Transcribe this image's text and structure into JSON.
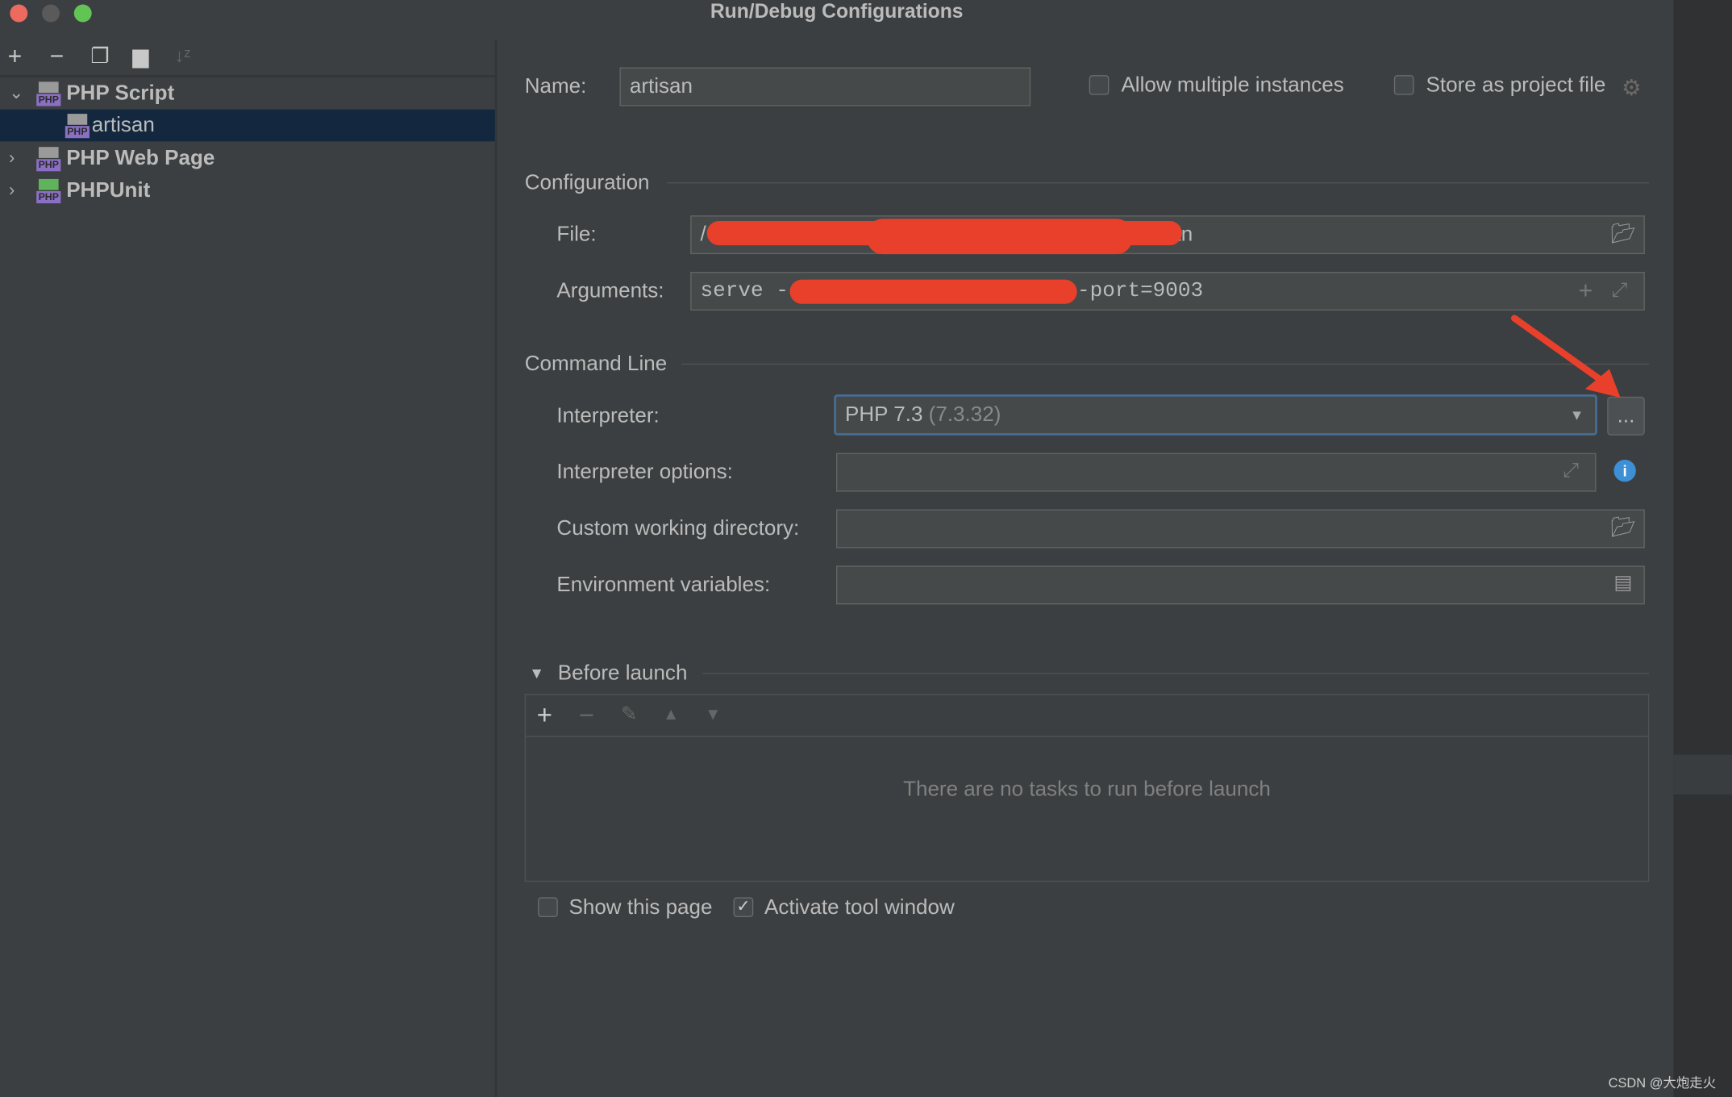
{
  "window": {
    "title": "Run/Debug Configurations"
  },
  "toolbar": {
    "icons": [
      "plus-icon",
      "minus-icon",
      "copy-icon",
      "folder-add-icon",
      "sort-icon"
    ]
  },
  "tree": {
    "items": [
      {
        "label": "PHP Script",
        "expanded": true
      },
      {
        "label": "artisan",
        "selected": true
      },
      {
        "label": "PHP Web Page",
        "expanded": false
      },
      {
        "label": "PHPUnit",
        "expanded": false
      }
    ],
    "badge": "PHP"
  },
  "form": {
    "name_label": "Name:",
    "name_value": "artisan",
    "allow_multiple": {
      "label": "Allow multiple instances",
      "checked": false
    },
    "store_project": {
      "label": "Store as project file",
      "checked": false
    },
    "configuration_title": "Configuration",
    "file_label": "File:",
    "file_value_prefix": "/",
    "file_value_suffix": "i/artisan",
    "arguments_label": "Arguments:",
    "arguments_value_prefix": "serve -",
    "arguments_value_suffix": "--port=9003",
    "command_line_title": "Command Line",
    "interpreter_label": "Interpreter:",
    "interpreter_value": "PHP 7.3",
    "interpreter_version": "(7.3.32)",
    "more_button": "...",
    "interpreter_options_label": "Interpreter options:",
    "interpreter_options_value": "",
    "working_dir_label": "Custom working directory:",
    "working_dir_value": "",
    "env_label": "Environment variables:",
    "env_value": ""
  },
  "before_launch": {
    "title": "Before launch",
    "empty_text": "There are no tasks to run before launch",
    "show_page": {
      "label": "Show this page",
      "checked": false
    },
    "activate_tool": {
      "label": "Activate tool window",
      "checked": true
    }
  },
  "watermark": "CSDN @大炮走火",
  "colors": {
    "background": "#3c3f41",
    "selection": "#13283f",
    "field": "#45494a",
    "accent_focus": "#466d94",
    "annotation_red": "#e8402a",
    "info": "#3d8fd6"
  }
}
